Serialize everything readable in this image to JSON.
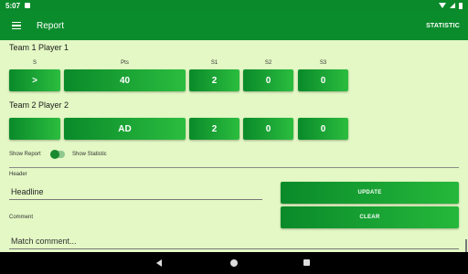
{
  "status": {
    "time": "5:07"
  },
  "appbar": {
    "title": "Report",
    "action": "STATISTIC"
  },
  "team1": {
    "label": "Team 1 Player 1",
    "serve": ">",
    "points": "40",
    "s1": "2",
    "s2": "0",
    "s3": "0"
  },
  "team2": {
    "label": "Team 2 Player 2",
    "serve": "",
    "points": "AD",
    "s1": "2",
    "s2": "0",
    "s3": "0"
  },
  "columns": {
    "serve": "S",
    "points": "Pts",
    "s1": "S1",
    "s2": "S2",
    "s3": "S3"
  },
  "toggle": {
    "left_label": "Show Report",
    "right_label": "Show Statistic"
  },
  "form": {
    "header_label": "Header",
    "header_value": "Headline",
    "comment_label": "Comment",
    "comment_placeholder": "Match comment...",
    "update_label": "UPDATE",
    "clear_label": "CLEAR"
  }
}
